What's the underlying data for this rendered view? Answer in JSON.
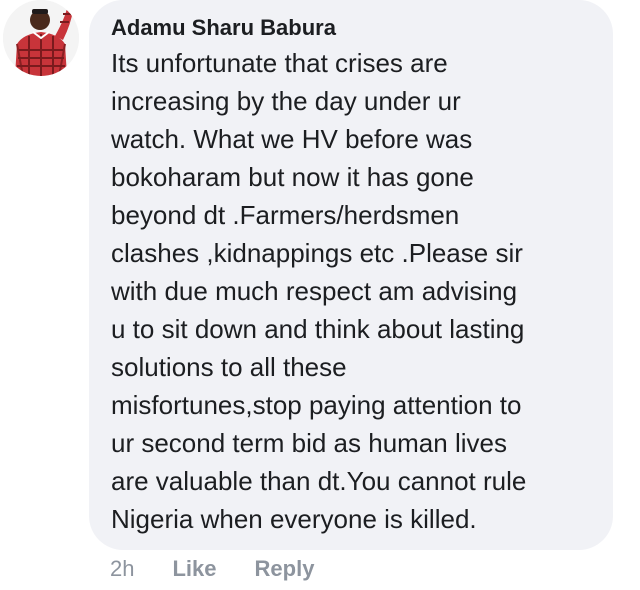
{
  "comment": {
    "author": "Adamu Sharu Babura",
    "lines": [
      "Its unfortunate that crises are",
      "increasing by the day under ur",
      "watch. What we HV before was",
      "bokoharam but now it has gone",
      "beyond dt .Farmers/herdsmen",
      "clashes ,kidnappings etc .Please sir",
      "with due much respect am advising",
      "u to sit down and think about lasting",
      "solutions to all these",
      "misfortunes,stop paying attention to",
      "ur second term bid as human lives",
      "are valuable than dt.You cannot rule",
      "Nigeria when everyone is killed."
    ]
  },
  "actions": {
    "time": "2h",
    "like": "Like",
    "reply": "Reply"
  },
  "colors": {
    "bubble": "#f1f2f6",
    "text": "#1c1e21",
    "meta": "#8d949e",
    "avatar_shirt": "#c8343a"
  },
  "icons": {
    "avatar": "profile-photo"
  }
}
